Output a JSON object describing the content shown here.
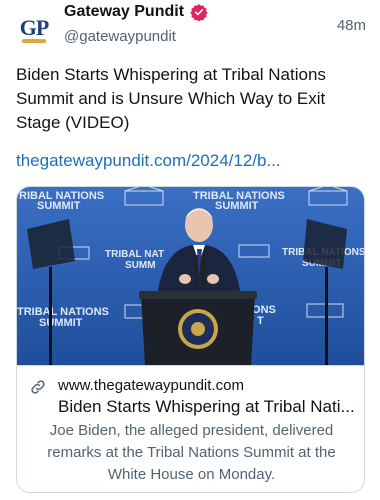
{
  "account": {
    "avatar_initials": "GP",
    "name": "Gateway Pundit",
    "handle": "@gatewaypundit",
    "time_ago": "48m"
  },
  "post": {
    "text": "Biden Starts Whispering at Tribal Nations Summit and is Unsure Which Way to Exit Stage (VIDEO)",
    "link": "thegatewaypundit.com/2024/12/b..."
  },
  "media": {
    "banner_lines": [
      "TRIBAL NATIONS",
      "SUMMIT"
    ],
    "banner_left_top": "RIBAL NATIONS",
    "banner_mid_partial": "TRIBAL NAT",
    "banner_mid_partial_2": "SUMM",
    "banner_right_partial": "TRIBAL NATIONS",
    "banner_right_partial_2": "SUMMIT",
    "banner_lower_left": "TRIBAL NATIONS",
    "banner_lower_mid": "IONS",
    "banner_lower_mid_2": "T"
  },
  "link_card": {
    "domain": "www.thegatewaypundit.com",
    "title": "Biden Starts Whispering at Tribal Nati...",
    "description": "Joe Biden, the alleged president, delivered remarks at the Tribal Nations Summit at the White House on Monday."
  },
  "colors": {
    "verified_badge": "#e0245e",
    "link": "#1d6fb8",
    "secondary_text": "#536471",
    "backdrop_blue": "#2c5fb3"
  }
}
